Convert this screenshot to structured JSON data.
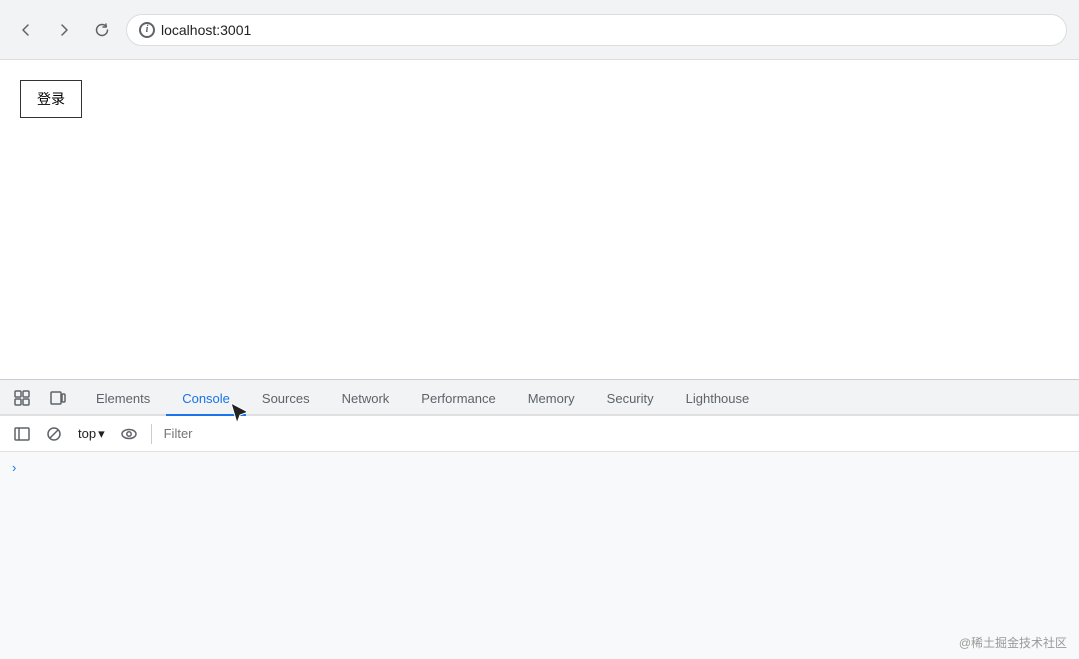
{
  "browser": {
    "url": "localhost:3001",
    "back_label": "←",
    "forward_label": "→",
    "reload_label": "↻",
    "info_label": "i"
  },
  "page": {
    "login_button_label": "登录"
  },
  "devtools": {
    "tabs": [
      {
        "id": "elements",
        "label": "Elements",
        "active": false
      },
      {
        "id": "console",
        "label": "Console",
        "active": true
      },
      {
        "id": "sources",
        "label": "Sources",
        "active": false
      },
      {
        "id": "network",
        "label": "Network",
        "active": false
      },
      {
        "id": "performance",
        "label": "Performance",
        "active": false
      },
      {
        "id": "memory",
        "label": "Memory",
        "active": false
      },
      {
        "id": "security",
        "label": "Security",
        "active": false
      },
      {
        "id": "lighthouse",
        "label": "Lighthouse",
        "active": false
      }
    ],
    "console_toolbar": {
      "top_label": "top",
      "dropdown_arrow": "▾",
      "filter_placeholder": "Filter"
    },
    "console_content": {
      "arrow": "›"
    }
  },
  "watermark": {
    "text": "@稀土掘金技术社区"
  }
}
